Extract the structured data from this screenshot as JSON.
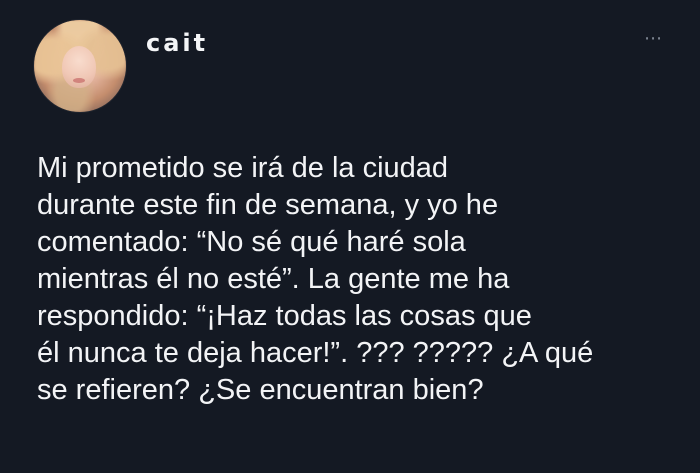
{
  "tweet": {
    "username": "cait",
    "menu_icon": "more-horizontal-icon",
    "lines": [
      "Mi prometido se irá de la ciudad",
      "durante este fin de semana, y yo he",
      "comentado: “No sé qué haré sola",
      "mientras él no esté”. La gente me ha",
      "respondido: “¡Haz todas las cosas que",
      "él nunca te deja hacer!”. ??? ????? ¿A qué",
      "se refieren? ¿Se encuentran bien?"
    ]
  },
  "colors": {
    "background": "#141923",
    "text": "#f3f4f6",
    "muted": "#7f8793"
  }
}
